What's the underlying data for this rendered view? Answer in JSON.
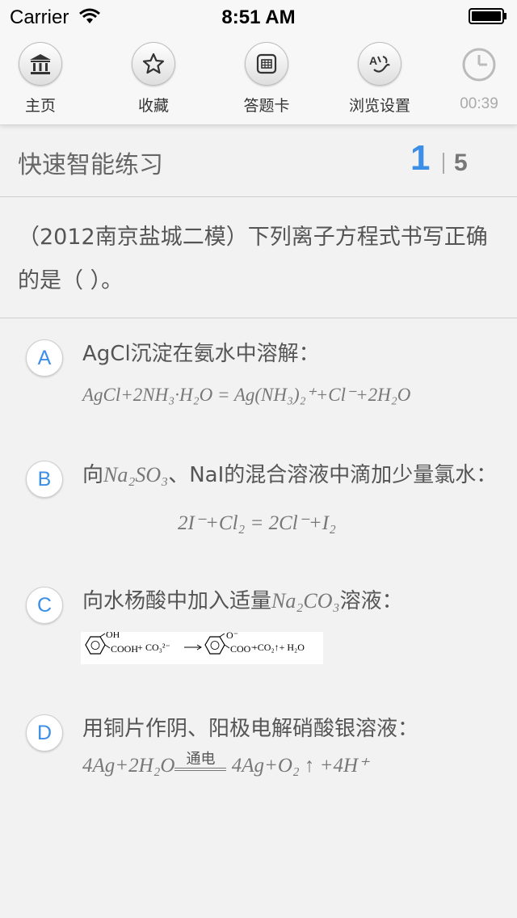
{
  "status_bar": {
    "carrier": "Carrier",
    "time": "8:51 AM"
  },
  "toolbar": {
    "items": [
      {
        "label": "主页",
        "icon": "bank-icon"
      },
      {
        "label": "收藏",
        "icon": "star-icon"
      },
      {
        "label": "答题卡",
        "icon": "answer-card-icon"
      },
      {
        "label": "浏览设置",
        "icon": "font-settings-icon"
      }
    ],
    "timer": {
      "icon": "clock-icon",
      "value": "00:39"
    }
  },
  "header": {
    "title": "快速智能练习",
    "current": "1",
    "total": "5"
  },
  "question": {
    "text": "（2012南京盐城二模）下列离子方程式书写正确的是（ ）。"
  },
  "options": [
    {
      "letter": "A",
      "text": "AgCl沉淀在氨水中溶解：",
      "formula": "AgCl+2NH₃·H₂O = Ag(NH₃)₂⁺+Cl⁻+2H₂O"
    },
    {
      "letter": "B",
      "text_before": "向",
      "formula_inline": "Na₂SO₃",
      "text_after": "、NaI的混合溶液中滴加少量氯水：",
      "formula": "2I⁻+Cl₂ = 2Cl⁻+I₂"
    },
    {
      "letter": "C",
      "text_before": "向水杨酸中加入适量",
      "formula_inline": "Na₂CO₃",
      "text_after": "溶液：",
      "image_text": {
        "oh": "OH",
        "cooh": "COOH",
        "plus1": "+",
        "co3": "CO₃²⁻",
        "o_minus": "O⁻",
        "coo": "COO⁻",
        "rest": "+CO₂↑+ H₂O"
      }
    },
    {
      "letter": "D",
      "text": "用铜片作阴、阳极电解硝酸银溶液：",
      "formula_left": "4Ag+2H₂O",
      "condition": "通电",
      "formula_right": "4Ag+O₂ ↑ +4H⁺"
    }
  ],
  "colors": {
    "accent": "#3d8ee6",
    "background": "#f2f2f2",
    "text": "#555555"
  }
}
